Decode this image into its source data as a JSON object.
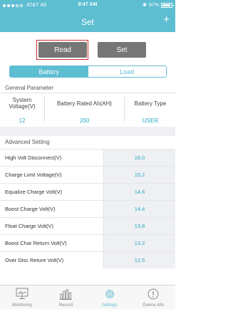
{
  "status_bar": {
    "carrier": "AT&T",
    "network": "4G",
    "time": "8:47 AM",
    "battery_percent": "97%"
  },
  "header": {
    "title": "Set",
    "add_label": "+"
  },
  "actions": {
    "read_label": "Read",
    "set_label": "Set"
  },
  "tabs": {
    "battery": "Battery",
    "load": "Load",
    "active": "battery"
  },
  "general": {
    "title": "General Parameter",
    "columns": [
      {
        "label_line1": "System",
        "label_line2": "Voltage(V)",
        "value": "12"
      },
      {
        "label_line1": "Battery Rated Ah(AH)",
        "label_line2": "",
        "value": "200"
      },
      {
        "label_line1": "Battery Type",
        "label_line2": "",
        "value": "USER"
      }
    ]
  },
  "advanced": {
    "title": "Advanced Setting",
    "rows": [
      {
        "label": "High Volt Disconnect(V)",
        "value": "16.0"
      },
      {
        "label": "Charge Limit Voltage(V)",
        "value": "15.2"
      },
      {
        "label": "Equalize Charge Volt(V)",
        "value": "14.6"
      },
      {
        "label": "Boost Charge Volt(V)",
        "value": "14.4"
      },
      {
        "label": "Float Charge Volt(V)",
        "value": "13.8"
      },
      {
        "label": "Boost Char Return Volt(V)",
        "value": "13.2"
      },
      {
        "label": "Over Disc Reture Volt(V)",
        "value": "12.5"
      }
    ]
  },
  "tabbar": {
    "items": [
      {
        "label": "Monitoring",
        "icon": "monitor-icon"
      },
      {
        "label": "Record",
        "icon": "bar-chart-icon"
      },
      {
        "label": "Settings",
        "icon": "gear-icon"
      },
      {
        "label": "Device Info",
        "icon": "info-icon"
      }
    ],
    "active": "Settings"
  },
  "colors": {
    "accent": "#5dbdd1",
    "button_gray": "#767676",
    "highlight_red": "#c8312f",
    "value_blue": "#2aa8c4"
  }
}
